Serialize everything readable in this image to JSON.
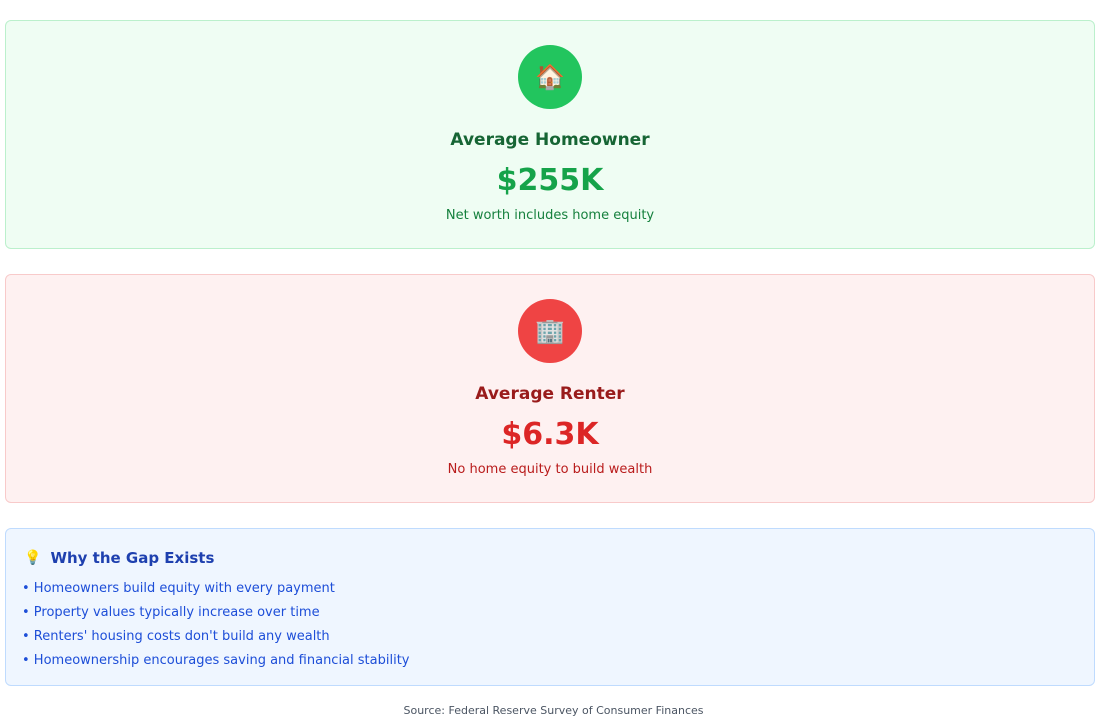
{
  "cards": {
    "homeowner": {
      "icon": "house-icon",
      "icon_glyph": "🏠",
      "title": "Average Homeowner",
      "value": "$255K",
      "description": "Net worth includes home equity",
      "accent": "#22c55e"
    },
    "renter": {
      "icon": "office-building-icon",
      "icon_glyph": "🏢",
      "title": "Average Renter",
      "value": "$6.3K",
      "description": "No home equity to build wealth",
      "accent": "#ef4444"
    }
  },
  "info": {
    "icon": "lightbulb-icon",
    "icon_glyph": "💡",
    "title": "Why the Gap Exists",
    "items": [
      "• Homeowners build equity with every payment",
      "• Property values typically increase over time",
      "• Renters' housing costs don't build any wealth",
      "• Homeownership encourages saving and financial stability"
    ]
  },
  "source": "Source: Federal Reserve Survey of Consumer Finances"
}
